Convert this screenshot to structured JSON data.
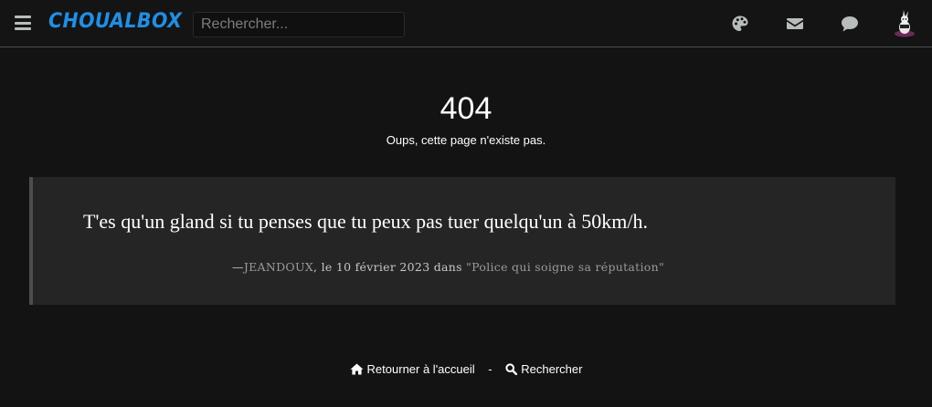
{
  "header": {
    "brand": "CHOUALBOX",
    "search_placeholder": "Rechercher...",
    "icons": [
      "menu-icon",
      "palette-icon",
      "envelope-icon",
      "comment-icon",
      "avatar"
    ]
  },
  "error": {
    "code": "404",
    "message": "Oups, cette page n'existe pas."
  },
  "quote": {
    "text": "T'es qu'un gland si tu penses que tu peux pas tuer quelqu'un à 50km/h.",
    "dash": "—",
    "author": "JEANDOUX",
    "middle": ", le 10 février 2023 dans ",
    "source": "\"Police qui soigne sa réputation\""
  },
  "footer": {
    "home_label": "Retourner à l'accueil",
    "separator": "-",
    "search_label": "Rechercher"
  },
  "colors": {
    "background": "#131313",
    "brand": "#1f8fe6",
    "quote_background": "#252525",
    "quote_border": "#4d4d4d"
  }
}
